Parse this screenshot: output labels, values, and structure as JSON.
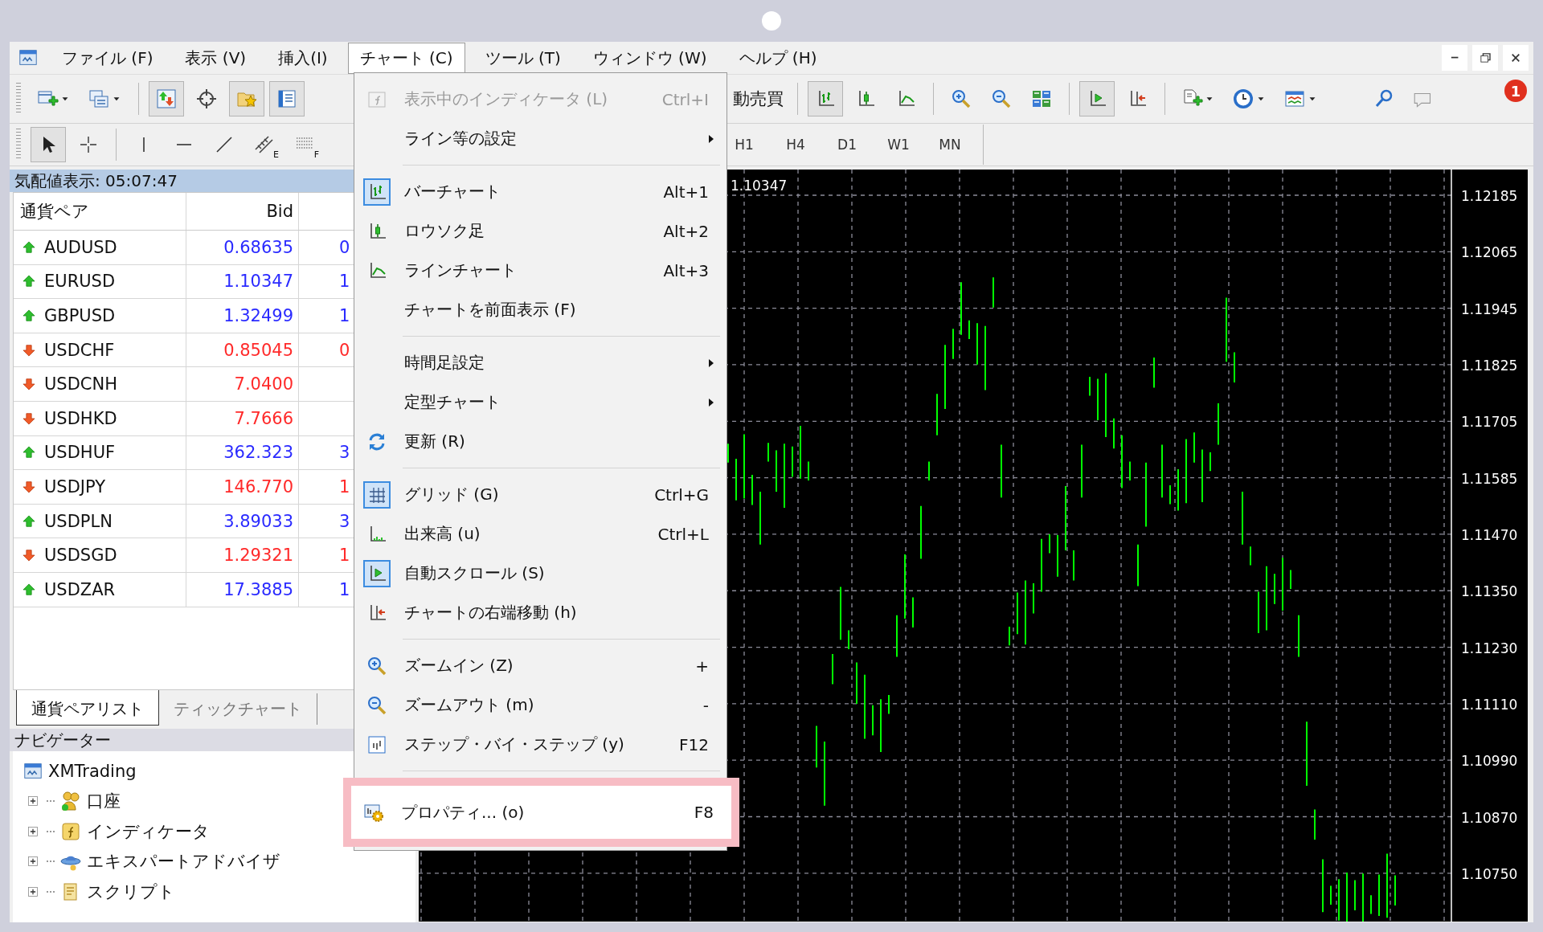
{
  "menu_bar": {
    "items": [
      {
        "label": "ファイル (F)",
        "selected": false
      },
      {
        "label": "表示 (V)",
        "selected": false
      },
      {
        "label": "挿入(I)",
        "selected": false
      },
      {
        "label": "チャート (C)",
        "selected": true
      },
      {
        "label": "ツール (T)",
        "selected": false
      },
      {
        "label": "ウィンドウ (W)",
        "selected": false
      },
      {
        "label": "ヘルプ (H)",
        "selected": false
      }
    ]
  },
  "toolbar": {
    "left": [
      {
        "kind": "new-chart",
        "pressed": false,
        "dropdown": true
      },
      {
        "kind": "profiles",
        "pressed": false,
        "dropdown": true
      },
      {
        "kind": "separator"
      },
      {
        "kind": "market-watch",
        "pressed": true,
        "dropdown": false
      },
      {
        "kind": "target",
        "pressed": false,
        "dropdown": false
      },
      {
        "kind": "folder-star",
        "pressed": true,
        "dropdown": false
      },
      {
        "kind": "panel",
        "pressed": true,
        "dropdown": false
      }
    ],
    "right": [
      {
        "kind": "text",
        "label": "動売買",
        "pressed": false,
        "dropdown": false
      },
      {
        "kind": "separator"
      },
      {
        "kind": "bar",
        "pressed": true,
        "dropdown": false
      },
      {
        "kind": "candle",
        "pressed": false,
        "dropdown": false
      },
      {
        "kind": "line",
        "pressed": false,
        "dropdown": false
      },
      {
        "kind": "separator"
      },
      {
        "kind": "zoomin",
        "pressed": false,
        "dropdown": false
      },
      {
        "kind": "zoomout",
        "pressed": false,
        "dropdown": false
      },
      {
        "kind": "tile",
        "pressed": false,
        "dropdown": false
      },
      {
        "kind": "separator"
      },
      {
        "kind": "autoscroll",
        "pressed": true,
        "dropdown": false
      },
      {
        "kind": "shift",
        "pressed": false,
        "dropdown": false
      },
      {
        "kind": "separator"
      },
      {
        "kind": "doc-plus",
        "pressed": false,
        "dropdown": true
      },
      {
        "kind": "clock",
        "pressed": false,
        "dropdown": true
      },
      {
        "kind": "template",
        "pressed": false,
        "dropdown": true
      }
    ],
    "notification_count": "1"
  },
  "drawing_toolbar": {
    "tools": [
      {
        "kind": "cursor",
        "pressed": true
      },
      {
        "kind": "plus-lines",
        "pressed": false
      },
      {
        "kind": "separator"
      },
      {
        "kind": "vline",
        "pressed": false
      },
      {
        "kind": "hline",
        "pressed": false
      },
      {
        "kind": "trend",
        "pressed": false
      },
      {
        "kind": "channel",
        "pressed": false,
        "letter": "E"
      },
      {
        "kind": "dotted-lines",
        "pressed": false,
        "letter": "F"
      }
    ],
    "timeframes": [
      "H1",
      "H4",
      "D1",
      "W1",
      "MN"
    ]
  },
  "market_watch": {
    "title": "気配値表示: 05:07:47",
    "columns": [
      "通貨ペア",
      "Bid"
    ],
    "rows": [
      {
        "symbol": "AUDUSD",
        "rising": true,
        "bid": "0.68635",
        "column_3": "0"
      },
      {
        "symbol": "EURUSD",
        "rising": true,
        "bid": "1.10347",
        "column_3": "1"
      },
      {
        "symbol": "GBPUSD",
        "rising": true,
        "bid": "1.32499",
        "column_3": "1"
      },
      {
        "symbol": "USDCHF",
        "rising": false,
        "bid": "0.85045",
        "column_3": "0"
      },
      {
        "symbol": "USDCNH",
        "rising": false,
        "bid": "7.0400"
      },
      {
        "symbol": "USDHKD",
        "rising": false,
        "bid": "7.7666"
      },
      {
        "symbol": "USDHUF",
        "rising": true,
        "bid": "362.323",
        "column_3": "3"
      },
      {
        "symbol": "USDJPY",
        "rising": false,
        "bid": "146.770",
        "column_3": "1"
      },
      {
        "symbol": "USDPLN",
        "rising": true,
        "bid": "3.89033",
        "column_3": "3"
      },
      {
        "symbol": "USDSGD",
        "rising": false,
        "bid": "1.29321",
        "column_3": "1"
      },
      {
        "symbol": "USDZAR",
        "rising": true,
        "bid": "17.3885",
        "column_3": "1"
      }
    ],
    "tabs": [
      {
        "label": "通貨ペアリスト",
        "selected": true
      },
      {
        "label": "ティックチャート",
        "selected": false
      }
    ]
  },
  "navigator": {
    "title": "ナビゲーター",
    "root": {
      "label": "XMTrading",
      "kind": "app",
      "children": [
        {
          "label": "口座",
          "kind": "accounts",
          "expanded": false
        },
        {
          "label": "インディケータ",
          "kind": "indicator-f",
          "expanded": false
        },
        {
          "label": "エキスパートアドバイザ",
          "kind": "expert",
          "expanded": false
        },
        {
          "label": "スクリプト",
          "kind": "script",
          "expanded": false
        }
      ]
    }
  },
  "chart": {
    "price_label": "1.10347",
    "grid": true,
    "price_scale": [
      "1.12185",
      "1.12065",
      "1.11945",
      "1.11825",
      "1.11705",
      "1.11585",
      "1.11470",
      "1.11350",
      "1.11230",
      "1.11110",
      "1.10990",
      "1.10870",
      "1.10750"
    ]
  },
  "chart_menu": {
    "items": [
      {
        "kind": "indicator-list",
        "label": "表示中のインディケータ (L)",
        "shortcut": "Ctrl+I",
        "checked": false,
        "disabled": true,
        "submenu": false,
        "highlighted": false
      },
      {
        "kind": "plain",
        "label": "ライン等の設定",
        "checked": false,
        "disabled": false,
        "submenu": true,
        "highlighted": false
      },
      {
        "kind": "separator"
      },
      {
        "kind": "bar",
        "label": "バーチャート",
        "shortcut": "Alt+1",
        "checked": true,
        "disabled": false,
        "submenu": false,
        "highlighted": false
      },
      {
        "kind": "candle",
        "label": "ロウソク足",
        "shortcut": "Alt+2",
        "checked": false,
        "disabled": false,
        "submenu": false,
        "highlighted": false
      },
      {
        "kind": "line",
        "label": "ラインチャート",
        "shortcut": "Alt+3",
        "checked": false,
        "disabled": false,
        "submenu": false,
        "highlighted": false
      },
      {
        "kind": "plain",
        "label": "チャートを前面表示 (F)",
        "checked": false,
        "disabled": false,
        "submenu": false,
        "highlighted": false
      },
      {
        "kind": "separator"
      },
      {
        "kind": "plain",
        "label": "時間足設定",
        "checked": false,
        "disabled": false,
        "submenu": true,
        "highlighted": false
      },
      {
        "kind": "plain",
        "label": "定型チャート",
        "checked": false,
        "disabled": false,
        "submenu": true,
        "highlighted": false
      },
      {
        "kind": "refresh",
        "label": "更新 (R)",
        "checked": false,
        "disabled": false,
        "submenu": false,
        "highlighted": false
      },
      {
        "kind": "separator"
      },
      {
        "kind": "grid",
        "label": "グリッド (G)",
        "shortcut": "Ctrl+G",
        "checked": true,
        "disabled": false,
        "submenu": false,
        "highlighted": false
      },
      {
        "kind": "volume",
        "label": "出来高 (u)",
        "shortcut": "Ctrl+L",
        "checked": false,
        "disabled": false,
        "submenu": false,
        "highlighted": false
      },
      {
        "kind": "autoscroll",
        "label": "自動スクロール (S)",
        "checked": true,
        "disabled": false,
        "submenu": false,
        "highlighted": false
      },
      {
        "kind": "shift",
        "label": "チャートの右端移動 (h)",
        "checked": false,
        "disabled": false,
        "submenu": false,
        "highlighted": false
      },
      {
        "kind": "separator"
      },
      {
        "kind": "zoomin",
        "label": "ズームイン (Z)",
        "shortcut": "+",
        "checked": false,
        "disabled": false,
        "submenu": false,
        "highlighted": false
      },
      {
        "kind": "zoomout",
        "label": "ズームアウト (m)",
        "shortcut": "-",
        "checked": false,
        "disabled": false,
        "submenu": false,
        "highlighted": false
      },
      {
        "kind": "step",
        "label": "ステップ・バイ・ステップ (y)",
        "shortcut": "F12",
        "checked": false,
        "disabled": false,
        "submenu": false,
        "highlighted": false
      },
      {
        "kind": "separator"
      },
      {
        "kind": "properties",
        "label": "プロパティ... (o)",
        "shortcut": "F8",
        "checked": false,
        "disabled": false,
        "submenu": false,
        "highlighted": true
      }
    ]
  }
}
